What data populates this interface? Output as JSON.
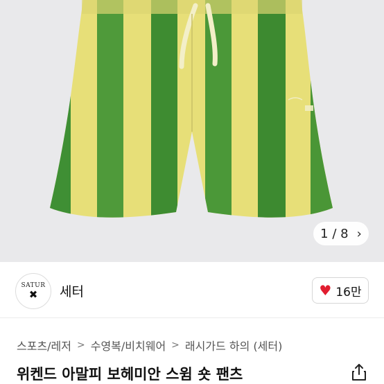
{
  "gallery": {
    "current": "1",
    "separator": "/",
    "total": "8",
    "colors": {
      "yellow": "#e8e07a",
      "green": "#4f9a3a",
      "background": "#e9e9eb"
    }
  },
  "seller": {
    "logo_text": "SATUR",
    "name": "세터",
    "likes": "16만"
  },
  "breadcrumb": [
    {
      "label": "스포츠/레저"
    },
    {
      "label": "수영복/비치웨어"
    },
    {
      "label": "래시가드 하의 (세터)"
    }
  ],
  "product": {
    "title": "위켄드 아말피 보헤미안 스윔 숏 팬츠"
  },
  "colors": {
    "like_heart": "#e11d2f"
  }
}
